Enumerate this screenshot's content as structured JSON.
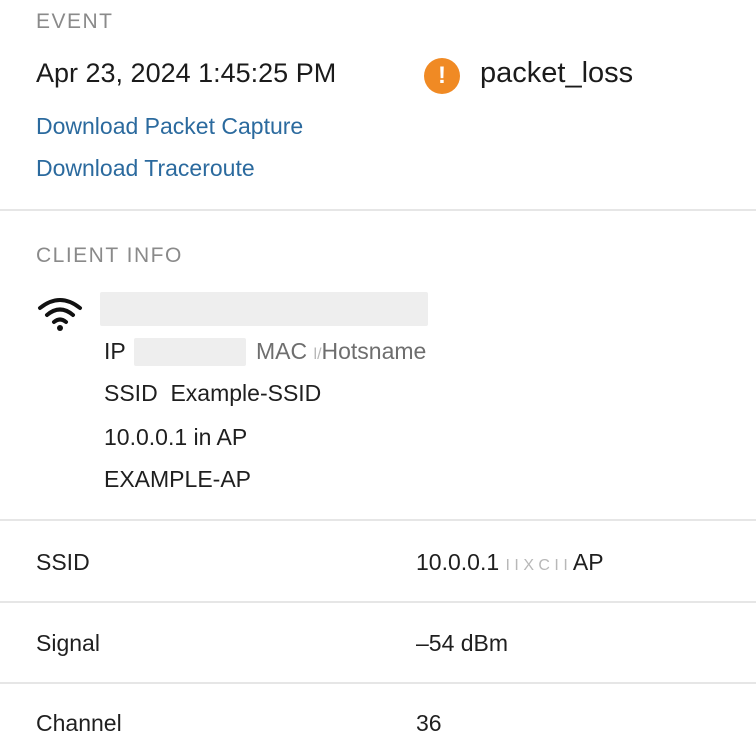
{
  "event": {
    "section_label": "EVENT",
    "timestamp": "Apr 23, 2024 1:45:25 PM",
    "alert_icon": "exclamation-circle-icon",
    "alert_color": "#f08a24",
    "type": "packet_loss",
    "links": [
      {
        "label": "Download Packet Capture"
      },
      {
        "label": "Download Traceroute"
      }
    ]
  },
  "client_info": {
    "section_label": "CLIENT INFO",
    "connection_icon": "wifi-icon",
    "ip_label": "IP",
    "mac_label": "MAC",
    "mac_sep": "l/",
    "hostname_label": "Hotsname",
    "ssid_label": "SSID",
    "ssid_value": "Example-SSID",
    "ap_line": "10.0.0.1 in AP",
    "ap_name": "EXAMPLE-AP"
  },
  "details": {
    "rows": [
      {
        "label": "SSID",
        "value": "10.0.0.1",
        "value_faint": "I I X C I I",
        "value_suffix": "AP"
      },
      {
        "label": "Signal",
        "value": "–54 dBm"
      },
      {
        "label": "Channel",
        "value": "36"
      }
    ]
  },
  "colors": {
    "link": "#2b6a9e",
    "section_label": "#8a8a8a",
    "divider": "#e6e6e6"
  }
}
